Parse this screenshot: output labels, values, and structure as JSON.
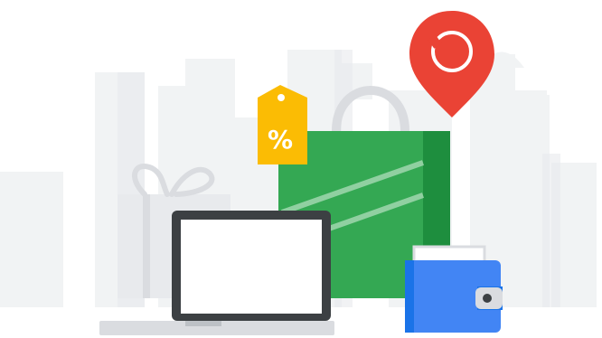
{
  "illustration": {
    "price_tag": {
      "symbol": "%",
      "color": "#fbbc04"
    },
    "location_pin": {
      "icon": "map-pin-icon",
      "color": "#ea4335"
    },
    "shopping_bag": {
      "icon": "shopping-bag-icon",
      "color": "#34a853",
      "accent": "#1e8e3e"
    },
    "laptop": {
      "icon": "laptop-icon",
      "frame": "#3c4043",
      "screen": "#ffffff"
    },
    "wallet": {
      "icon": "wallet-icon",
      "color": "#4285f4"
    },
    "gift": {
      "icon": "gift-icon",
      "color": "#e8eaed"
    },
    "skyline": {
      "icon": "city-skyline-icon",
      "color": "#f1f3f4"
    }
  }
}
